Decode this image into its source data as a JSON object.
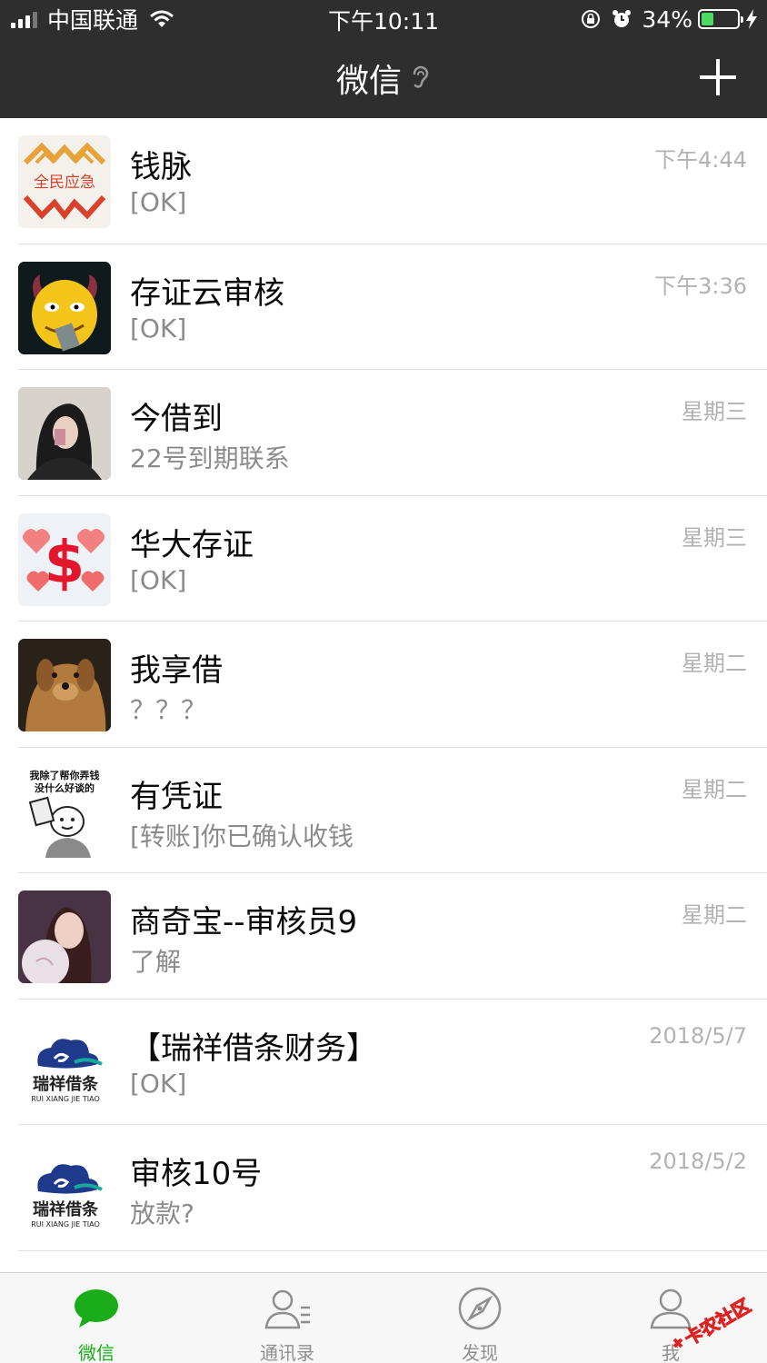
{
  "status_bar": {
    "carrier": "中国联通",
    "time": "下午10:11",
    "battery": "34%",
    "battery_level": 0.34
  },
  "nav": {
    "title": "微信"
  },
  "chats": [
    {
      "name": "钱脉",
      "preview": "[OK]",
      "time": "下午4:44"
    },
    {
      "name": "存证云审核",
      "preview": "[OK]",
      "time": "下午3:36"
    },
    {
      "name": "今借到",
      "preview": "22号到期联系",
      "time": "星期三"
    },
    {
      "name": "华大存证",
      "preview": "[OK]",
      "time": "星期三"
    },
    {
      "name": "我享借",
      "preview": "？？？",
      "time": "星期二"
    },
    {
      "name": "有凭证",
      "preview": "[转账]你已确认收钱",
      "time": "星期二"
    },
    {
      "name": "商奇宝--审核员9",
      "preview": "了解",
      "time": "星期二"
    },
    {
      "name": "【瑞祥借条财务】",
      "preview": "[OK]",
      "time": "2018/5/7"
    },
    {
      "name": "审核10号",
      "preview": "放款?",
      "time": "2018/5/2"
    }
  ],
  "avatars": {
    "qianmai": {
      "line1": "全民应急"
    },
    "youpingzheng": {
      "line1": "我除了帮你弄钱",
      "line2": "没什么好谈的"
    },
    "ruixiang": {
      "line1": "瑞祥借条",
      "line2": "RUI XIANG JIE TIAO"
    }
  },
  "tabs": [
    {
      "label": "微信",
      "icon": "chat-bubble-icon",
      "active": true
    },
    {
      "label": "通讯录",
      "icon": "contacts-icon",
      "active": false
    },
    {
      "label": "发现",
      "icon": "compass-icon",
      "active": false
    },
    {
      "label": "我",
      "icon": "person-icon",
      "active": false
    }
  ],
  "watermark": "卡农社区",
  "colors": {
    "header_bg": "#2e2e2f",
    "active_green": "#1aad19",
    "battery_green": "#4cd964"
  }
}
